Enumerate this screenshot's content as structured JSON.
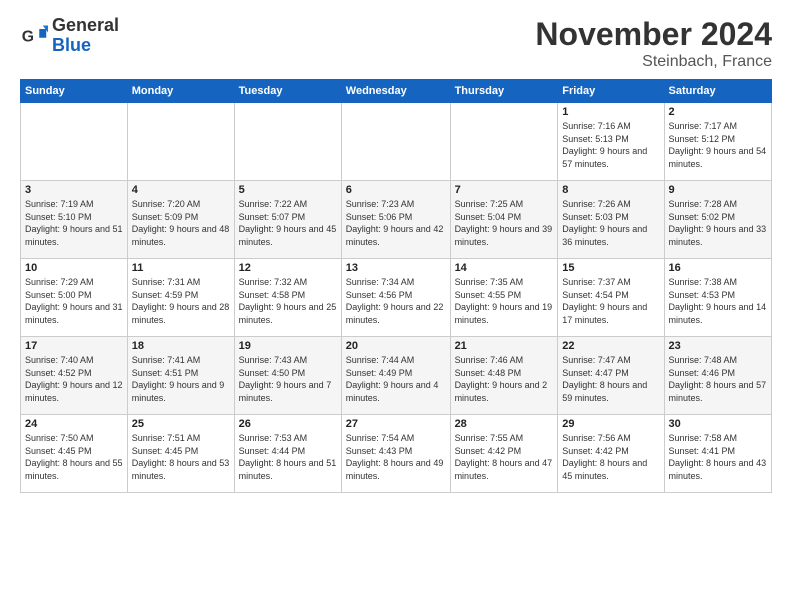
{
  "logo": {
    "general": "General",
    "blue": "Blue"
  },
  "header": {
    "title": "November 2024",
    "subtitle": "Steinbach, France"
  },
  "weekdays": [
    "Sunday",
    "Monday",
    "Tuesday",
    "Wednesday",
    "Thursday",
    "Friday",
    "Saturday"
  ],
  "weeks": [
    [
      {
        "day": "",
        "info": ""
      },
      {
        "day": "",
        "info": ""
      },
      {
        "day": "",
        "info": ""
      },
      {
        "day": "",
        "info": ""
      },
      {
        "day": "",
        "info": ""
      },
      {
        "day": "1",
        "info": "Sunrise: 7:16 AM\nSunset: 5:13 PM\nDaylight: 9 hours and 57 minutes."
      },
      {
        "day": "2",
        "info": "Sunrise: 7:17 AM\nSunset: 5:12 PM\nDaylight: 9 hours and 54 minutes."
      }
    ],
    [
      {
        "day": "3",
        "info": "Sunrise: 7:19 AM\nSunset: 5:10 PM\nDaylight: 9 hours and 51 minutes."
      },
      {
        "day": "4",
        "info": "Sunrise: 7:20 AM\nSunset: 5:09 PM\nDaylight: 9 hours and 48 minutes."
      },
      {
        "day": "5",
        "info": "Sunrise: 7:22 AM\nSunset: 5:07 PM\nDaylight: 9 hours and 45 minutes."
      },
      {
        "day": "6",
        "info": "Sunrise: 7:23 AM\nSunset: 5:06 PM\nDaylight: 9 hours and 42 minutes."
      },
      {
        "day": "7",
        "info": "Sunrise: 7:25 AM\nSunset: 5:04 PM\nDaylight: 9 hours and 39 minutes."
      },
      {
        "day": "8",
        "info": "Sunrise: 7:26 AM\nSunset: 5:03 PM\nDaylight: 9 hours and 36 minutes."
      },
      {
        "day": "9",
        "info": "Sunrise: 7:28 AM\nSunset: 5:02 PM\nDaylight: 9 hours and 33 minutes."
      }
    ],
    [
      {
        "day": "10",
        "info": "Sunrise: 7:29 AM\nSunset: 5:00 PM\nDaylight: 9 hours and 31 minutes."
      },
      {
        "day": "11",
        "info": "Sunrise: 7:31 AM\nSunset: 4:59 PM\nDaylight: 9 hours and 28 minutes."
      },
      {
        "day": "12",
        "info": "Sunrise: 7:32 AM\nSunset: 4:58 PM\nDaylight: 9 hours and 25 minutes."
      },
      {
        "day": "13",
        "info": "Sunrise: 7:34 AM\nSunset: 4:56 PM\nDaylight: 9 hours and 22 minutes."
      },
      {
        "day": "14",
        "info": "Sunrise: 7:35 AM\nSunset: 4:55 PM\nDaylight: 9 hours and 19 minutes."
      },
      {
        "day": "15",
        "info": "Sunrise: 7:37 AM\nSunset: 4:54 PM\nDaylight: 9 hours and 17 minutes."
      },
      {
        "day": "16",
        "info": "Sunrise: 7:38 AM\nSunset: 4:53 PM\nDaylight: 9 hours and 14 minutes."
      }
    ],
    [
      {
        "day": "17",
        "info": "Sunrise: 7:40 AM\nSunset: 4:52 PM\nDaylight: 9 hours and 12 minutes."
      },
      {
        "day": "18",
        "info": "Sunrise: 7:41 AM\nSunset: 4:51 PM\nDaylight: 9 hours and 9 minutes."
      },
      {
        "day": "19",
        "info": "Sunrise: 7:43 AM\nSunset: 4:50 PM\nDaylight: 9 hours and 7 minutes."
      },
      {
        "day": "20",
        "info": "Sunrise: 7:44 AM\nSunset: 4:49 PM\nDaylight: 9 hours and 4 minutes."
      },
      {
        "day": "21",
        "info": "Sunrise: 7:46 AM\nSunset: 4:48 PM\nDaylight: 9 hours and 2 minutes."
      },
      {
        "day": "22",
        "info": "Sunrise: 7:47 AM\nSunset: 4:47 PM\nDaylight: 8 hours and 59 minutes."
      },
      {
        "day": "23",
        "info": "Sunrise: 7:48 AM\nSunset: 4:46 PM\nDaylight: 8 hours and 57 minutes."
      }
    ],
    [
      {
        "day": "24",
        "info": "Sunrise: 7:50 AM\nSunset: 4:45 PM\nDaylight: 8 hours and 55 minutes."
      },
      {
        "day": "25",
        "info": "Sunrise: 7:51 AM\nSunset: 4:45 PM\nDaylight: 8 hours and 53 minutes."
      },
      {
        "day": "26",
        "info": "Sunrise: 7:53 AM\nSunset: 4:44 PM\nDaylight: 8 hours and 51 minutes."
      },
      {
        "day": "27",
        "info": "Sunrise: 7:54 AM\nSunset: 4:43 PM\nDaylight: 8 hours and 49 minutes."
      },
      {
        "day": "28",
        "info": "Sunrise: 7:55 AM\nSunset: 4:42 PM\nDaylight: 8 hours and 47 minutes."
      },
      {
        "day": "29",
        "info": "Sunrise: 7:56 AM\nSunset: 4:42 PM\nDaylight: 8 hours and 45 minutes."
      },
      {
        "day": "30",
        "info": "Sunrise: 7:58 AM\nSunset: 4:41 PM\nDaylight: 8 hours and 43 minutes."
      }
    ]
  ]
}
